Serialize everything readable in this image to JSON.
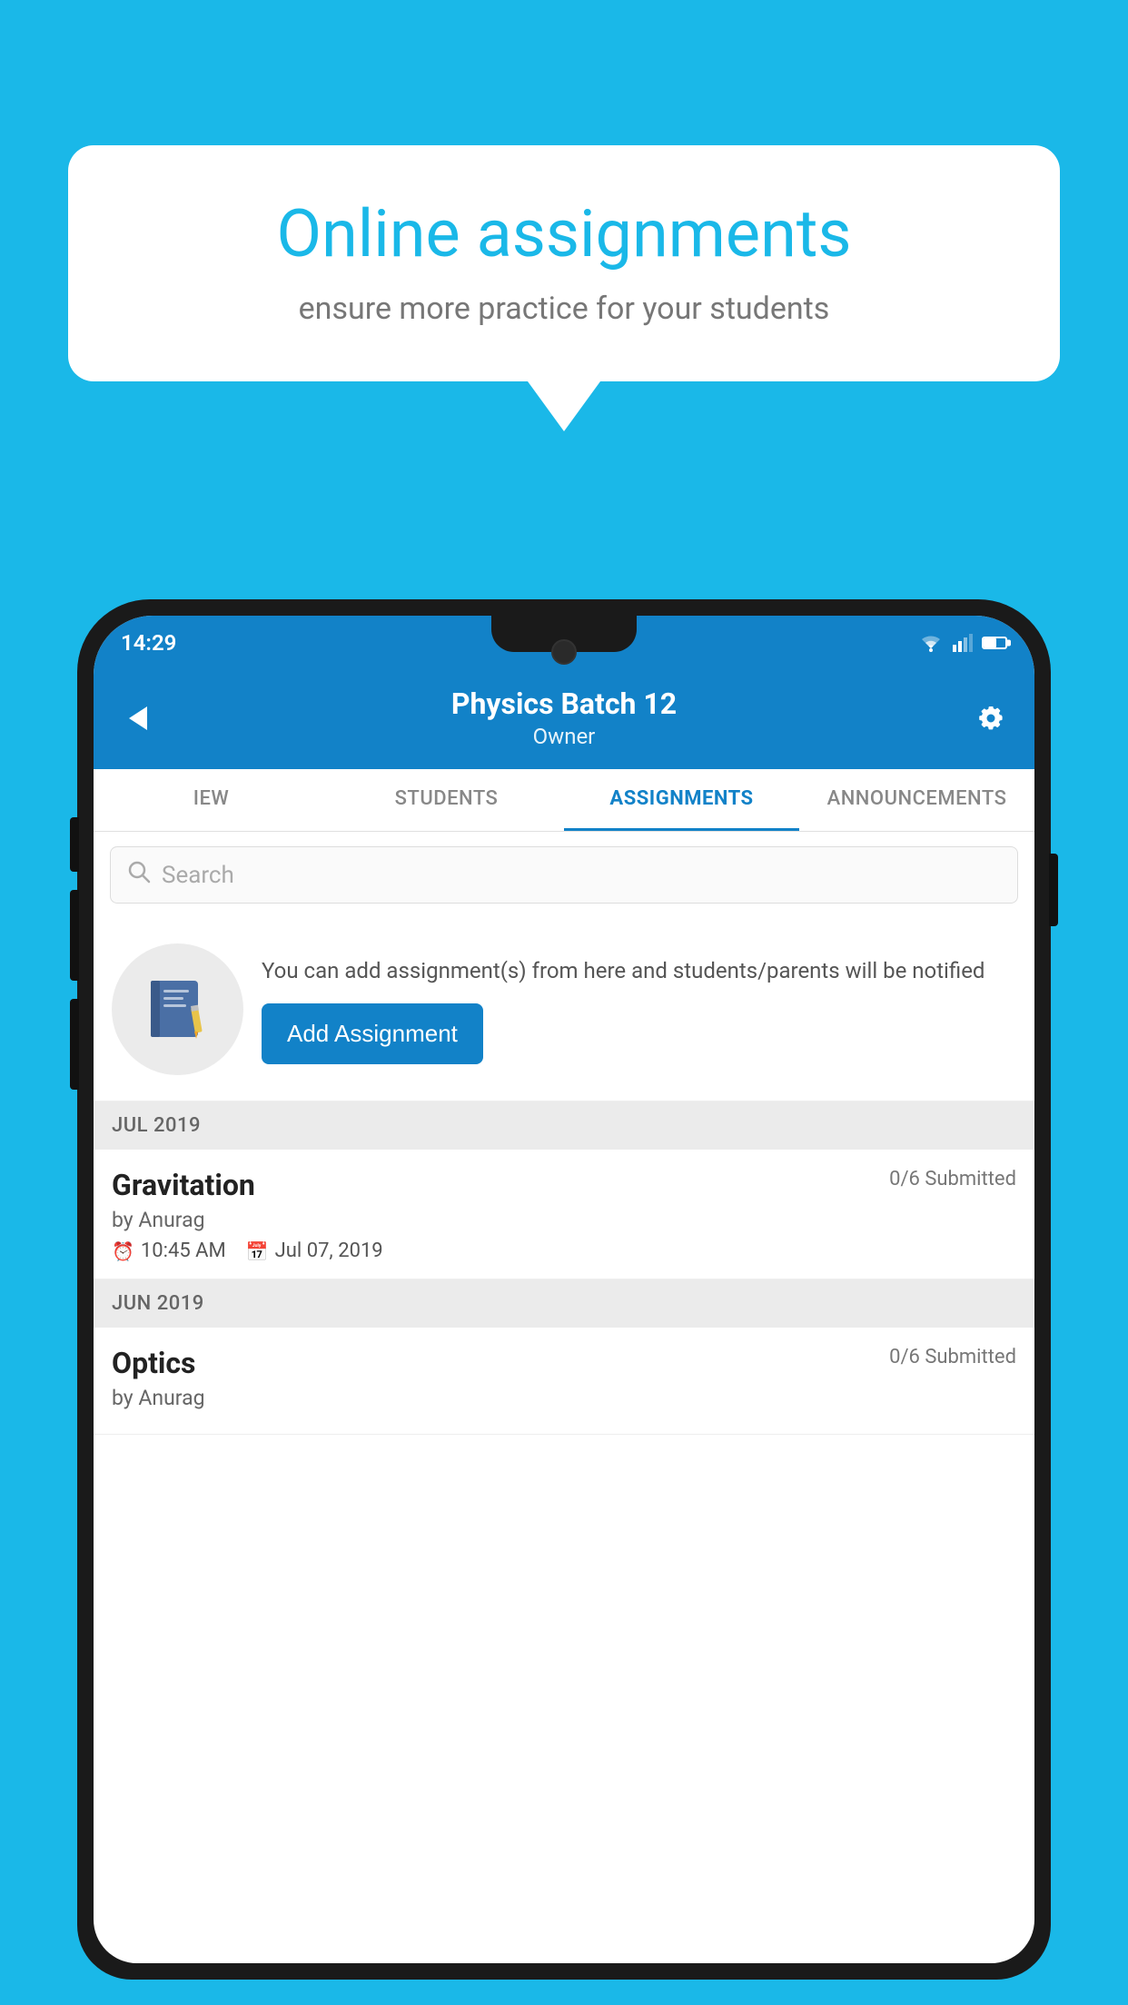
{
  "background": {
    "color": "#1ab8e8"
  },
  "speech_bubble": {
    "title": "Online assignments",
    "subtitle": "ensure more practice for your students"
  },
  "phone": {
    "status_bar": {
      "time": "14:29"
    },
    "header": {
      "title": "Physics Batch 12",
      "subtitle": "Owner",
      "back_label": "back"
    },
    "tabs": [
      {
        "label": "IEW",
        "active": false
      },
      {
        "label": "STUDENTS",
        "active": false
      },
      {
        "label": "ASSIGNMENTS",
        "active": true
      },
      {
        "label": "ANNOUNCEMENTS",
        "active": false
      }
    ],
    "search": {
      "placeholder": "Search"
    },
    "promo": {
      "text": "You can add assignment(s) from here and students/parents will be notified",
      "button_label": "Add Assignment"
    },
    "sections": [
      {
        "month": "JUL 2019",
        "assignments": [
          {
            "name": "Gravitation",
            "submitted": "0/6 Submitted",
            "by": "by Anurag",
            "time": "10:45 AM",
            "date": "Jul 07, 2019"
          }
        ]
      },
      {
        "month": "JUN 2019",
        "assignments": [
          {
            "name": "Optics",
            "submitted": "0/6 Submitted",
            "by": "by Anurag",
            "time": "",
            "date": ""
          }
        ]
      }
    ]
  }
}
